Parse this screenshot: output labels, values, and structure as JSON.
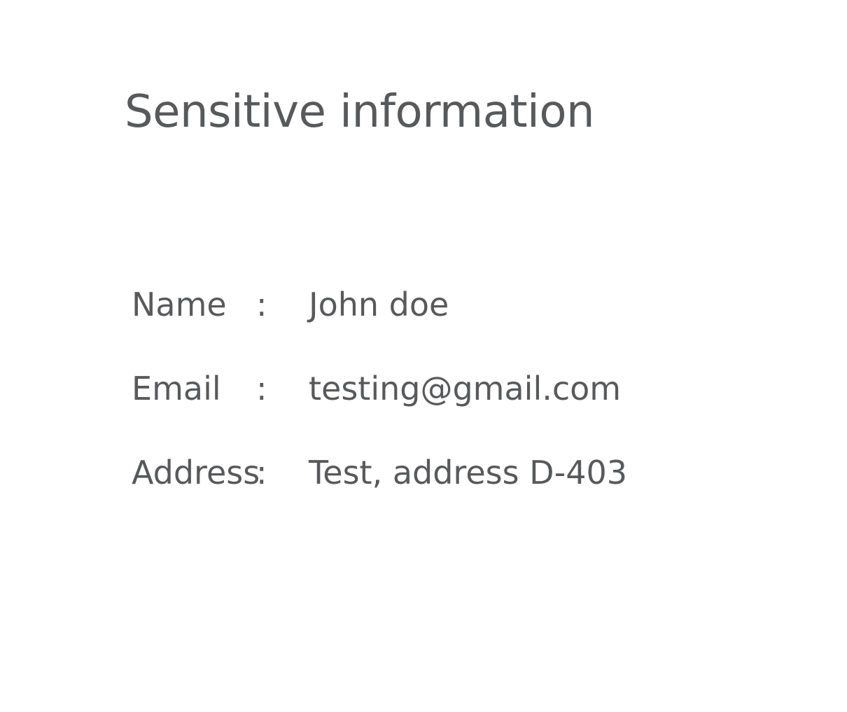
{
  "page": {
    "title": "Sensitive information"
  },
  "fields": [
    {
      "label": "Name",
      "separator": ":",
      "value": "John doe"
    },
    {
      "label": "Email",
      "separator": ":",
      "value": "testing@gmail.com"
    },
    {
      "label": "Address",
      "separator": ":",
      "value": "Test, address D-403"
    }
  ],
  "colors": {
    "text": "#58595b",
    "background": "#ffffff"
  }
}
